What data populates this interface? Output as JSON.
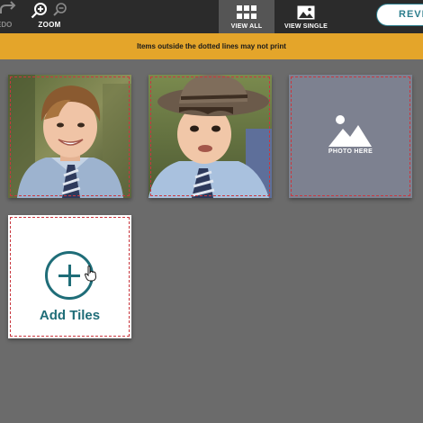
{
  "toolbar": {
    "redo_label": "EDO",
    "zoom_label": "ZOOM",
    "tabs": [
      {
        "label": "VIEW ALL",
        "icon": "grid-icon",
        "active": true
      },
      {
        "label": "VIEW SINGLE",
        "icon": "image-icon",
        "active": false
      }
    ],
    "review_label": "REVIE"
  },
  "banner": {
    "text": "Items outside the dotted lines may not print"
  },
  "tiles": [
    {
      "type": "photo",
      "icon": "photo-boy-smiling"
    },
    {
      "type": "photo",
      "icon": "photo-boy-hat"
    },
    {
      "type": "placeholder",
      "label": "PHOTO HERE",
      "icon": "mountain-sun-icon"
    }
  ],
  "add_tiles": {
    "label": "Add Tiles",
    "icon": "plus-circle-icon"
  },
  "colors": {
    "accent": "#1f6d78",
    "banner": "#e4a52a",
    "toolbar": "#2b2b2b",
    "canvas": "#6b6b6b",
    "bleed": "#c9373f"
  }
}
